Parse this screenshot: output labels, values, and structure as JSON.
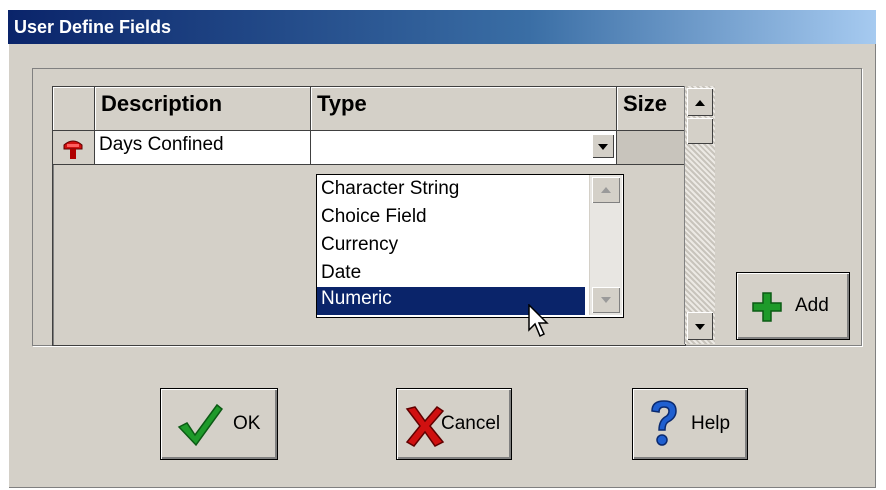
{
  "window": {
    "title": "User Define Fields"
  },
  "grid": {
    "columns": [
      "Description",
      "Type",
      "Size"
    ],
    "rows": [
      {
        "description": "Days Confined",
        "type": "",
        "size": ""
      }
    ],
    "row_icon": "red-mailbox-icon"
  },
  "type_dropdown": {
    "options": [
      "Character String",
      "Choice Field",
      "Currency",
      "Date",
      "Numeric"
    ],
    "selected": "Numeric"
  },
  "buttons": {
    "add": {
      "label": "Add",
      "icon": "green-plus-icon"
    },
    "ok": {
      "label": "OK",
      "icon": "green-checkmark-icon"
    },
    "cancel": {
      "label": "Cancel",
      "icon": "red-x-icon"
    },
    "help": {
      "label": "Help",
      "icon": "blue-question-icon"
    }
  },
  "colors": {
    "selection": "#0a246a",
    "title_gradient_start": "#0a246a",
    "dialog_face": "#d4d0c8"
  }
}
